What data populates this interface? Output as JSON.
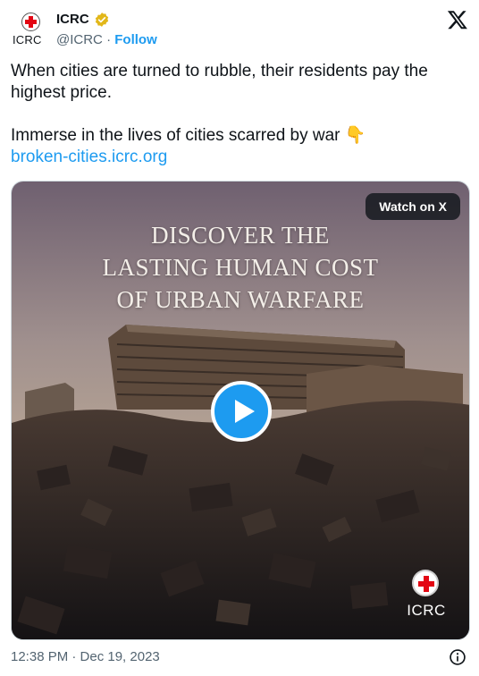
{
  "account": {
    "name": "ICRC",
    "handle": "@ICRC",
    "separator": "·",
    "follow_label": "Follow",
    "avatar_text": "ICRC"
  },
  "tweet": {
    "line1": "When cities are turned to rubble, their residents pay the highest price.",
    "line2": "Immerse in the lives of cities scarred by war",
    "emoji": "👇",
    "link": "broken-cities.icrc.org"
  },
  "media": {
    "headline": [
      "DISCOVER THE",
      "LASTING HUMAN COST",
      "OF URBAN WARFARE"
    ],
    "watch_label": "Watch on X",
    "logo_text": "ICRC"
  },
  "timestamp": "12:38 PM · Dec 19, 2023",
  "colors": {
    "accent": "#1d9bf0",
    "text": "#0f1419",
    "muted": "#536471",
    "red_cross": "#e30613",
    "verified_gold": "#e2b719"
  },
  "icons": [
    "red-cross-emblem",
    "verified-badge-icon",
    "x-logo-icon",
    "play-icon",
    "info-icon"
  ]
}
